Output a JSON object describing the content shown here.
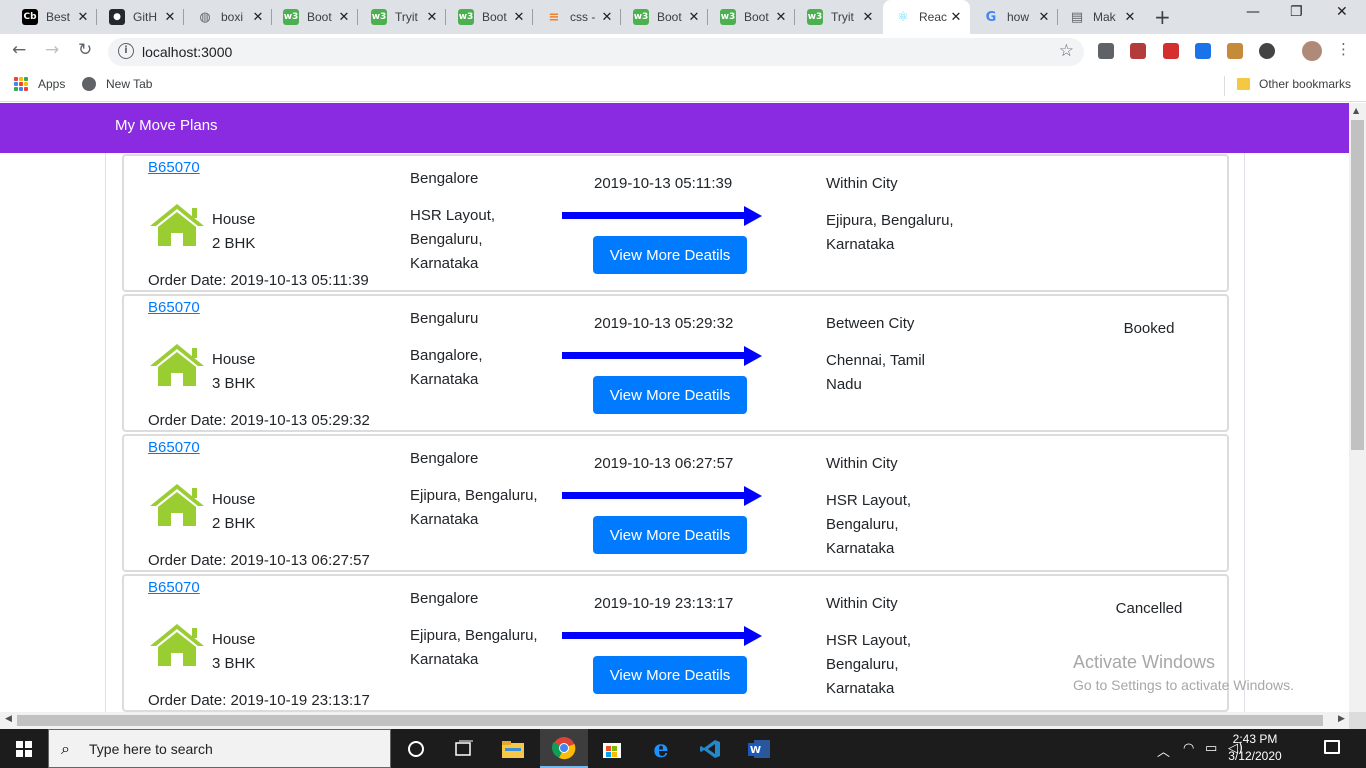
{
  "browser": {
    "tabs": [
      {
        "title": "Best",
        "favicon": "cb-icon",
        "color": "#000000",
        "glyph": "Cb",
        "active": false
      },
      {
        "title": "GitH",
        "favicon": "github-icon",
        "color": "#24292e",
        "glyph": "●",
        "active": false
      },
      {
        "title": "boxi",
        "favicon": "globe-icon",
        "color": "#5f6368",
        "glyph": "◍",
        "active": false
      },
      {
        "title": "Boot",
        "favicon": "w3schools-icon",
        "color": "#4caf50",
        "glyph": "w3",
        "active": false
      },
      {
        "title": "Tryit",
        "favicon": "w3schools-icon",
        "color": "#4caf50",
        "glyph": "w3",
        "active": false
      },
      {
        "title": "Boot",
        "favicon": "w3schools-icon",
        "color": "#4caf50",
        "glyph": "w3",
        "active": false
      },
      {
        "title": "css -",
        "favicon": "stackoverflow-icon",
        "color": "#f48024",
        "glyph": "≡",
        "active": false
      },
      {
        "title": "Boot",
        "favicon": "w3schools-icon",
        "color": "#4caf50",
        "glyph": "w3",
        "active": false
      },
      {
        "title": "Boot",
        "favicon": "w3schools-icon",
        "color": "#4caf50",
        "glyph": "w3",
        "active": false
      },
      {
        "title": "Tryit",
        "favicon": "w3schools-icon",
        "color": "#4caf50",
        "glyph": "w3",
        "active": false
      },
      {
        "title": "Reac",
        "favicon": "react-icon",
        "color": "#61dafb",
        "glyph": "⚛",
        "active": true
      },
      {
        "title": "how",
        "favicon": "google-icon",
        "color": "#4285f4",
        "glyph": "G",
        "active": false
      },
      {
        "title": "Mak",
        "favicon": "document-icon",
        "color": "#5f6368",
        "glyph": "▤",
        "active": false
      }
    ],
    "url": "localhost:3000",
    "bookmarks": {
      "apps": "Apps",
      "new_tab": "New Tab",
      "other": "Other bookmarks"
    },
    "extension_colors": [
      "#5f6368",
      "#b33b3b",
      "#d32f2f",
      "#1a73e8",
      "#c58a3a",
      "#444444"
    ]
  },
  "app": {
    "brand": "My Move Plans",
    "button_label": "View More Deatils",
    "order_date_prefix": "Order Date: ",
    "colors": {
      "navbar": "#8a2be2",
      "house": "#9acd32",
      "arrow": "#0000ff",
      "button": "#007bff"
    },
    "plans": [
      {
        "id": "B65070",
        "type": "House",
        "size": "2 BHK",
        "order_date": "2019-10-13 05:11:39",
        "from_city": "Bengalore",
        "from_address": [
          "HSR Layout,",
          "Bengaluru,",
          "Karnataka"
        ],
        "date": "2019-10-13 05:11:39",
        "move_type": "Within City",
        "to_address": [
          "Ejipura, Bengaluru,",
          "Karnataka"
        ],
        "status": ""
      },
      {
        "id": "B65070",
        "type": "House",
        "size": "3 BHK",
        "order_date": "2019-10-13 05:29:32",
        "from_city": "Bengaluru",
        "from_address": [
          "Bangalore,",
          "Karnataka"
        ],
        "date": "2019-10-13 05:29:32",
        "move_type": "Between City",
        "to_address": [
          "Chennai, Tamil",
          "Nadu"
        ],
        "status": "Booked"
      },
      {
        "id": "B65070",
        "type": "House",
        "size": "2 BHK",
        "order_date": "2019-10-13 06:27:57",
        "from_city": "Bengalore",
        "from_address": [
          "Ejipura, Bengaluru,",
          "Karnataka"
        ],
        "date": "2019-10-13 06:27:57",
        "move_type": "Within City",
        "to_address": [
          "HSR Layout,",
          "Bengaluru,",
          "Karnataka"
        ],
        "status": ""
      },
      {
        "id": "B65070",
        "type": "House",
        "size": "3 BHK",
        "order_date": "2019-10-19 23:13:17",
        "from_city": "Bengalore",
        "from_address": [
          "Ejipura, Bengaluru,",
          "Karnataka"
        ],
        "date": "2019-10-19 23:13:17",
        "move_type": "Within City",
        "to_address": [
          "HSR Layout,",
          "Bengaluru,",
          "Karnataka"
        ],
        "status": "Cancelled"
      }
    ]
  },
  "watermark": {
    "title": "Activate Windows",
    "subtitle": "Go to Settings to activate Windows."
  },
  "taskbar": {
    "search_placeholder": "Type here to search",
    "time": "2:43 PM",
    "date": "3/12/2020",
    "apps": [
      "cortana-icon",
      "task-view-icon",
      "file-explorer-icon",
      "chrome-icon",
      "store-icon",
      "edge-icon",
      "vscode-icon",
      "word-icon"
    ]
  }
}
